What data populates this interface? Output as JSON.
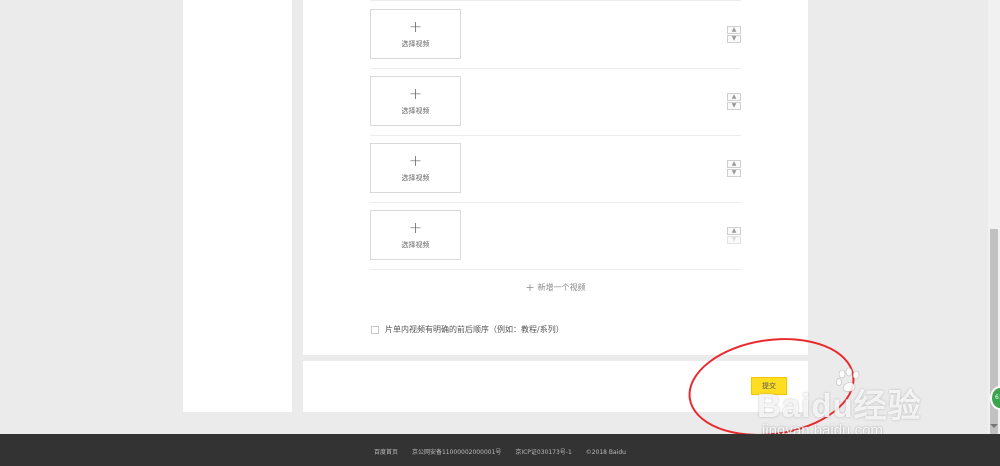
{
  "form": {
    "video_slots": [
      {
        "label": "选择视频"
      },
      {
        "label": "选择视频"
      },
      {
        "label": "选择视频"
      },
      {
        "label": "选择视频"
      }
    ],
    "add_video_label": "新增一个视频",
    "order_checkbox_label": "片单内视频有明确的前后顺序（例如：教程/系列）",
    "order_checkbox_checked": false
  },
  "actions": {
    "submit_label": "提交"
  },
  "footer": {
    "links": [
      "百度首页",
      "京公网安备11000002000001号",
      "京ICP证030173号-1",
      "©2018 Baidu"
    ]
  },
  "watermark": {
    "brand": "Baidu经验",
    "url": "jingyan.baidu.com"
  },
  "side_badge": {
    "text": "61"
  },
  "colors": {
    "accent": "#ffde21",
    "highlight": "#e8292d",
    "footer_bg": "#333333",
    "page_bg": "#ebebeb"
  }
}
